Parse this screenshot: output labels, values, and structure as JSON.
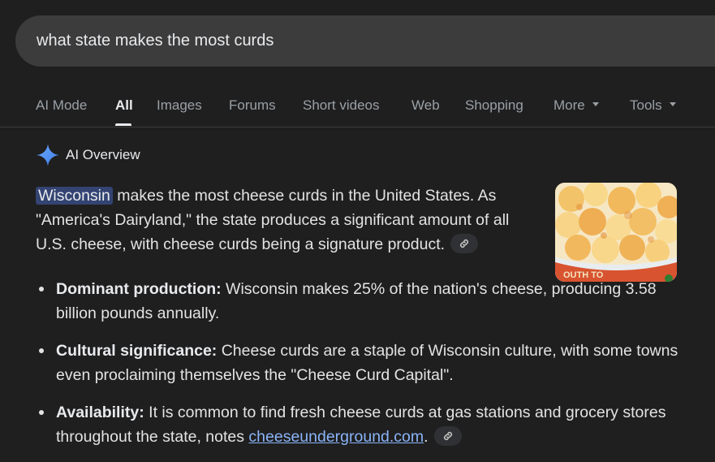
{
  "search": {
    "query": "what state makes the most curds"
  },
  "tabs": [
    {
      "label": "AI Mode"
    },
    {
      "label": "All"
    },
    {
      "label": "Images"
    },
    {
      "label": "Forums"
    },
    {
      "label": "Short videos"
    },
    {
      "label": "Web"
    },
    {
      "label": "Shopping"
    },
    {
      "label": "More"
    },
    {
      "label": "Tools"
    }
  ],
  "active_tab": "All",
  "ai_overview": {
    "title": "AI Overview",
    "highlight": "Wisconsin",
    "intro_line": " makes the most cheese curds in the United States. As \"America's Dairyland,\" the state produces a significant amount of all U.S. cheese, with cheese curds being a signature product.",
    "image_caption_fragment": "OUTH TO",
    "bullets": [
      {
        "label": "Dominant production:",
        "text": " Wisconsin makes 25% of the nation's cheese, producing 3.58 billion pounds annually."
      },
      {
        "label": "Cultural significance:",
        "text": " Cheese curds are a staple of Wisconsin culture, with some towns even proclaiming themselves the \"Cheese Curd Capital\"."
      },
      {
        "label": "Availability:",
        "text": " It is common to find fresh cheese curds at gas stations and grocery stores throughout the state, notes ",
        "link": "cheeseunderground.com",
        "after": "."
      }
    ]
  },
  "icons": {
    "sparkle": "sparkle-icon",
    "link": "link-icon",
    "caret": "caret-down-icon"
  },
  "colors": {
    "background": "#1f1f1f",
    "search_bg": "#3c3c3c",
    "highlight": "#334372",
    "link": "#8ab4f8",
    "sparkle": "#4c8df6"
  }
}
